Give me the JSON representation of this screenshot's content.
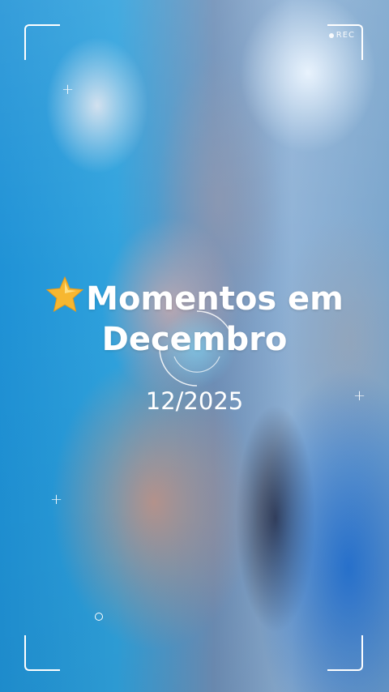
{
  "overlay": {
    "recording_label": "REC"
  },
  "title": {
    "icon": "star-icon",
    "line1": "Momentos em",
    "line2": "Decembro"
  },
  "date": "12/2025",
  "colors": {
    "text": "#ffffff",
    "star": "#f7b731"
  }
}
